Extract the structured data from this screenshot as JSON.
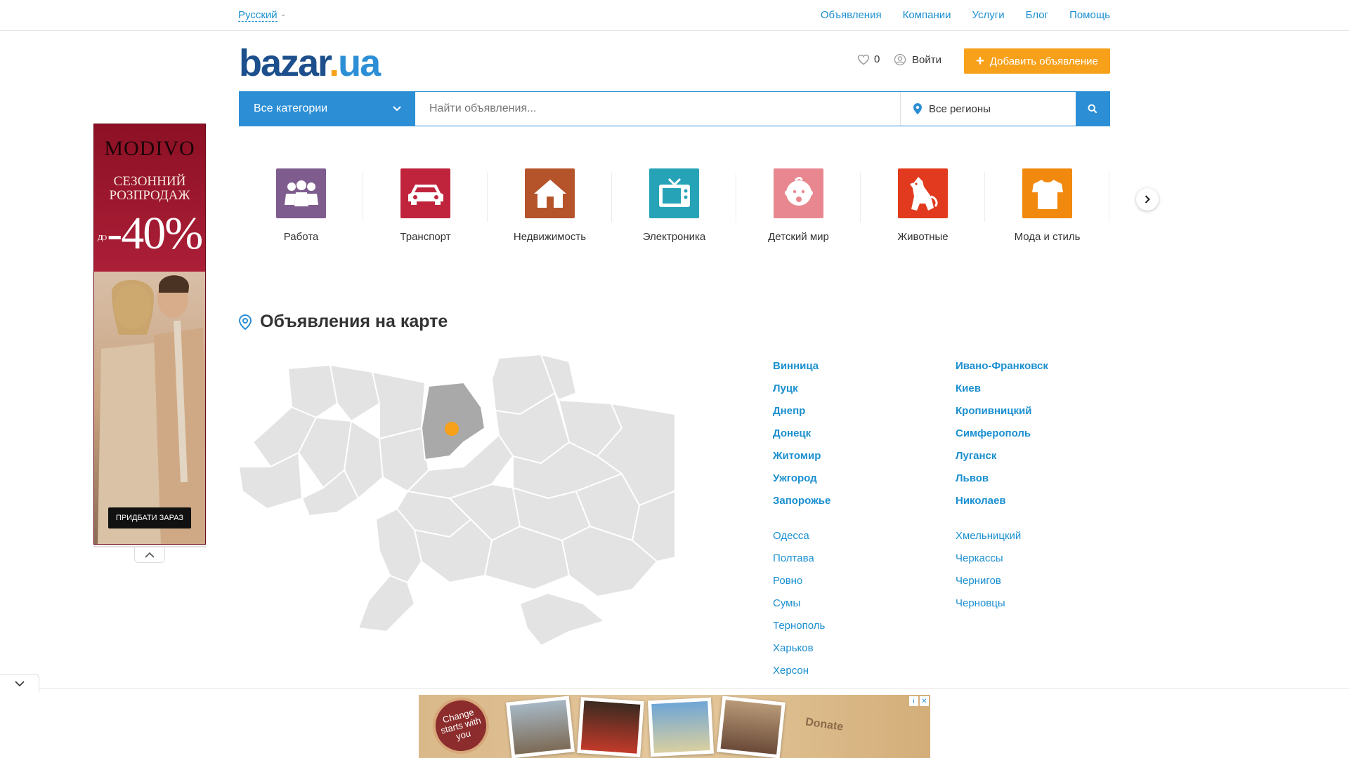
{
  "topbar": {
    "language": "Русский",
    "nav": [
      "Объявления",
      "Компании",
      "Услуги",
      "Блог",
      "Помощь"
    ]
  },
  "header": {
    "logo_main": "bazar",
    "logo_dot": ".",
    "logo_tld": "ua",
    "favorites_count": "0",
    "login_label": "Войти",
    "add_button_label": "Добавить объявление"
  },
  "search": {
    "category_label": "Все категории",
    "placeholder": "Найти объявления...",
    "region_label": "Все регионы"
  },
  "side_ad": {
    "brand": "MODIVO",
    "line1": "СЕЗОННИЙ",
    "line2": "РОЗПРОДАЖ",
    "prefix": "ДО",
    "percent": "-40%",
    "cta": "ПРИДБАТИ ЗАРАЗ"
  },
  "categories": [
    {
      "label": "Работа",
      "color": "#7e5c8e",
      "icon": "people-icon"
    },
    {
      "label": "Транспорт",
      "color": "#c0243c",
      "icon": "car-icon"
    },
    {
      "label": "Недвижимость",
      "color": "#b5532a",
      "icon": "house-icon"
    },
    {
      "label": "Электроника",
      "color": "#27a3b7",
      "icon": "tv-icon"
    },
    {
      "label": "Детский мир",
      "color": "#e8878f",
      "icon": "baby-icon"
    },
    {
      "label": "Животные",
      "color": "#e23a1e",
      "icon": "dog-icon"
    },
    {
      "label": "Мода и стиль",
      "color": "#f2890f",
      "icon": "shirt-icon"
    }
  ],
  "map_section": {
    "title": "Объявления на карте",
    "highlighted_region_color": "#a9a9a9",
    "marker_color": "#f7a11a",
    "cities_col1_bold": [
      "Винница",
      "Луцк",
      "Днепр",
      "Донецк",
      "Житомир",
      "Ужгород",
      "Запорожье"
    ],
    "cities_col2_bold": [
      "Ивано-Франковск",
      "Киев",
      "Кропивницкий",
      "Симферополь",
      "Луганск",
      "Львов",
      "Николаев"
    ],
    "cities_col1": [
      "Одесса",
      "Полтава",
      "Ровно",
      "Сумы",
      "Тернополь",
      "Харьков",
      "Херсон"
    ],
    "cities_col2": [
      "Хмельницкий",
      "Черкассы",
      "Чернигов",
      "Черновцы"
    ]
  },
  "bottom_ad": {
    "stamp_text": "Change starts with you",
    "donate": "Donate"
  }
}
